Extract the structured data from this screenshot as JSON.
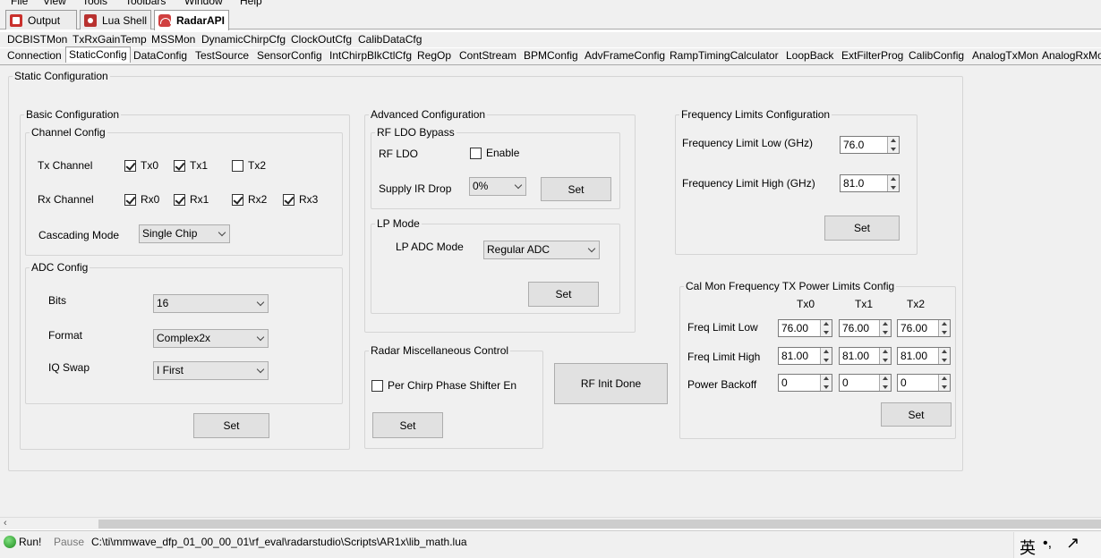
{
  "menu": {
    "items": [
      "File",
      "View",
      "Tools",
      "Toolbars",
      "Window",
      "Help"
    ]
  },
  "app_tabs": [
    {
      "label": "Output"
    },
    {
      "label": "Lua Shell"
    },
    {
      "label": "RadarAPI"
    }
  ],
  "tabs_row1": [
    "DCBISTMon",
    "TxRxGainTemp",
    "MSSMon",
    "DynamicChirpCfg",
    "ClockOutCfg",
    "CalibDataCfg"
  ],
  "tabs_row2": [
    "Connection",
    "StaticConfig",
    "DataConfig",
    "TestSource",
    "SensorConfig",
    "IntChirpBlkCtlCfg",
    "RegOp",
    "ContStream",
    "BPMConfig",
    "AdvFrameConfig",
    "RampTimingCalculator",
    "LoopBack",
    "ExtFilterProg",
    "CalibConfig",
    "AnalogTxMon",
    "AnalogRxMon"
  ],
  "static": {
    "title": "Static Configuration",
    "basic": {
      "title": "Basic Configuration",
      "channel": {
        "title": "Channel Config",
        "tx_label": "Tx Channel",
        "tx": [
          {
            "label": "Tx0",
            "checked": true
          },
          {
            "label": "Tx1",
            "checked": true
          },
          {
            "label": "Tx2",
            "checked": false
          }
        ],
        "rx_label": "Rx Channel",
        "rx": [
          {
            "label": "Rx0",
            "checked": true
          },
          {
            "label": "Rx1",
            "checked": true
          },
          {
            "label": "Rx2",
            "checked": true
          },
          {
            "label": "Rx3",
            "checked": true
          }
        ],
        "cascading_label": "Cascading Mode",
        "cascading_value": "Single Chip"
      },
      "adc": {
        "title": "ADC Config",
        "bits_label": "Bits",
        "bits_value": "16",
        "format_label": "Format",
        "format_value": "Complex2x",
        "iq_label": "IQ Swap",
        "iq_value": "I First",
        "set_label": "Set"
      }
    },
    "advanced": {
      "title": "Advanced Configuration",
      "ldo": {
        "title": "RF LDO Bypass",
        "rf_ldo_label": "RF LDO",
        "enable_label": "Enable",
        "enable_checked": false,
        "supply_label": "Supply IR Drop",
        "supply_value": "0%",
        "set_label": "Set"
      },
      "lp": {
        "title": "LP Mode",
        "adc_mode_label": "LP ADC Mode",
        "adc_mode_value": "Regular ADC",
        "set_label": "Set"
      }
    },
    "misc": {
      "title": "Radar Miscellaneous Control",
      "phase_label": "Per Chirp Phase Shifter En",
      "phase_checked": false,
      "set_label": "Set"
    },
    "rf_init_label": "RF Init Done",
    "freq": {
      "title": "Frequency Limits Configuration",
      "low_label": "Frequency Limit Low (GHz)",
      "low_value": "76.0",
      "high_label": "Frequency Limit High (GHz)",
      "high_value": "81.0",
      "set_label": "Set"
    },
    "calmon": {
      "title": "Cal Mon Frequency TX Power Limits Config",
      "headers": [
        "Tx0",
        "Tx1",
        "Tx2"
      ],
      "rows": [
        {
          "label": "Freq Limit Low",
          "values": [
            "76.00",
            "76.00",
            "76.00"
          ]
        },
        {
          "label": "Freq Limit High",
          "values": [
            "81.00",
            "81.00",
            "81.00"
          ]
        },
        {
          "label": "Power Backoff",
          "values": [
            "0",
            "0",
            "0"
          ]
        }
      ],
      "set_label": "Set"
    }
  },
  "status": {
    "run_label": "Run!",
    "pause_label": "Pause",
    "path": "C:\\ti\\mmwave_dfp_01_00_00_01\\rf_eval\\radarstudio\\Scripts\\AR1x\\lib_math.lua",
    "ime_label": "英"
  }
}
